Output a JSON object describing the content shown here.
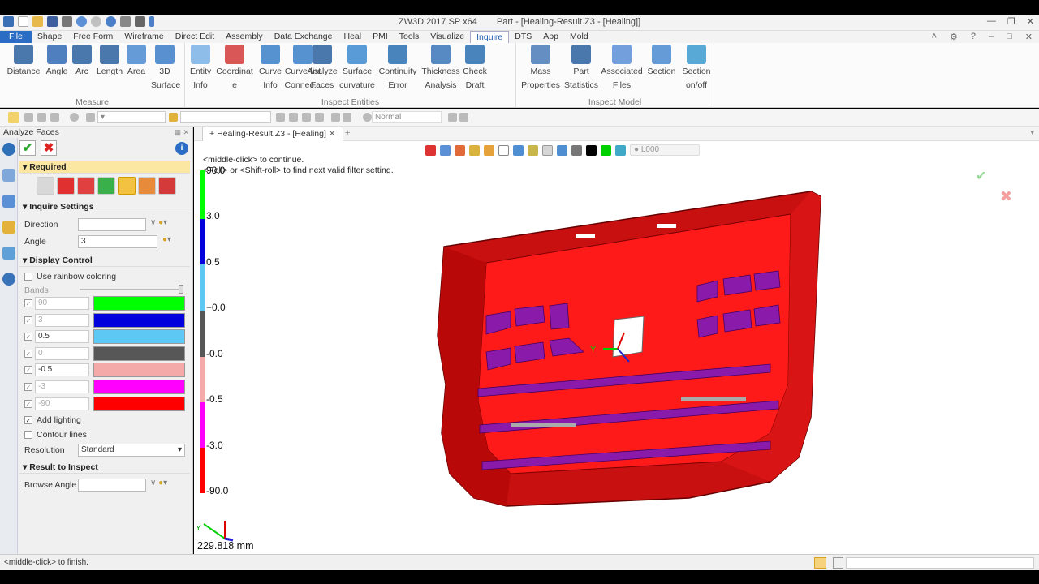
{
  "window": {
    "title": "ZW3D 2017 SP x64",
    "doc_title": "Part - [Healing-Result.Z3 - [Healing]]"
  },
  "menu": [
    "File",
    "Shape",
    "Free Form",
    "Wireframe",
    "Direct Edit",
    "Assembly",
    "Data Exchange",
    "Heal",
    "PMI",
    "Tools",
    "Visualize",
    "Inquire",
    "DTS",
    "App",
    "Mold"
  ],
  "menu_active": "Inquire",
  "ribbon": {
    "groups": [
      {
        "label": "Measure",
        "buttons": [
          {
            "line1": "Distance",
            "line2": "",
            "icon": "distance-icon"
          },
          {
            "line1": "Angle",
            "line2": "",
            "icon": "angle-icon"
          },
          {
            "line1": "Arc",
            "line2": "",
            "icon": "arc-icon"
          },
          {
            "line1": "Length",
            "line2": "",
            "icon": "length-icon"
          },
          {
            "line1": "Area",
            "line2": "",
            "icon": "area-icon"
          },
          {
            "line1": "3D",
            "line2": "Surface",
            "icon": "surface-3d-icon"
          }
        ]
      },
      {
        "label": "Inspect Entities",
        "buttons": [
          {
            "line1": "Entity",
            "line2": "Info",
            "icon": "entity-info-icon"
          },
          {
            "line1": "Coordinat",
            "line2": "e",
            "icon": "coordinate-icon"
          },
          {
            "line1": "Curve",
            "line2": "Info",
            "icon": "curve-info-icon"
          },
          {
            "line1": "Curve-list",
            "line2": "Connec...",
            "icon": "curve-list-icon"
          },
          {
            "line1": "Analyze",
            "line2": "Faces",
            "icon": "analyze-faces-icon"
          },
          {
            "line1": "Surface",
            "line2": "curvature",
            "icon": "surface-curvature-icon"
          },
          {
            "line1": "Continuity",
            "line2": "Error",
            "icon": "continuity-icon"
          },
          {
            "line1": "Thickness",
            "line2": "Analysis",
            "icon": "thickness-icon"
          },
          {
            "line1": "Check",
            "line2": "Draft",
            "icon": "check-draft-icon"
          }
        ]
      },
      {
        "label": "Inspect Model",
        "buttons": [
          {
            "line1": "Mass",
            "line2": "Properties",
            "icon": "mass-icon"
          },
          {
            "line1": "Part",
            "line2": "Statistics",
            "icon": "part-stats-icon"
          },
          {
            "line1": "Associated",
            "line2": "Files",
            "icon": "assoc-files-icon"
          },
          {
            "line1": "Section",
            "line2": "",
            "icon": "section-icon"
          },
          {
            "line1": "Section",
            "line2": "on/off",
            "icon": "section-onoff-icon"
          }
        ]
      }
    ]
  },
  "toolbar2": {
    "style_combo": "Normal"
  },
  "panel": {
    "title": "Analyze Faces",
    "required": "Required",
    "inquire_settings": "Inquire Settings",
    "direction_label": "Direction",
    "direction_value": "",
    "angle_label": "Angle",
    "angle_value": "3",
    "display_control": "Display Control",
    "use_rainbow": "Use rainbow coloring",
    "bands_label": "Bands",
    "bands": [
      {
        "value": "90",
        "color": "#00ff00",
        "enabled": false
      },
      {
        "value": "3",
        "color": "#0000dd",
        "enabled": false
      },
      {
        "value": "0.5",
        "color": "#5ec8f5",
        "enabled": true
      },
      {
        "value": "0",
        "color": "#575757",
        "enabled": false
      },
      {
        "value": "-0.5",
        "color": "#f5aaaa",
        "enabled": true
      },
      {
        "value": "-3",
        "color": "#ff00ff",
        "enabled": false
      },
      {
        "value": "-90",
        "color": "#ff0000",
        "enabled": false
      }
    ],
    "add_lighting": "Add lighting",
    "contour_lines": "Contour lines",
    "resolution_label": "Resolution",
    "resolution_value": "Standard",
    "result_to_inspect": "Result to Inspect",
    "browse_angle_label": "Browse Angle",
    "browse_angle_value": ""
  },
  "viewport": {
    "tab": "Healing-Result.Z3 - [Healing]",
    "prompt1": "<middle-click> to continue.",
    "prompt2": "<Roll> or <Shift-roll> to find next valid filter setting.",
    "layer": "L000",
    "legend": [
      "90.0",
      "3.0",
      "0.5",
      "+0.0",
      "-0.0",
      "-0.5",
      "-3.0",
      "-90.0"
    ],
    "scale": "229.818 mm",
    "axis_y": "Y"
  },
  "status": "<middle-click> to finish."
}
